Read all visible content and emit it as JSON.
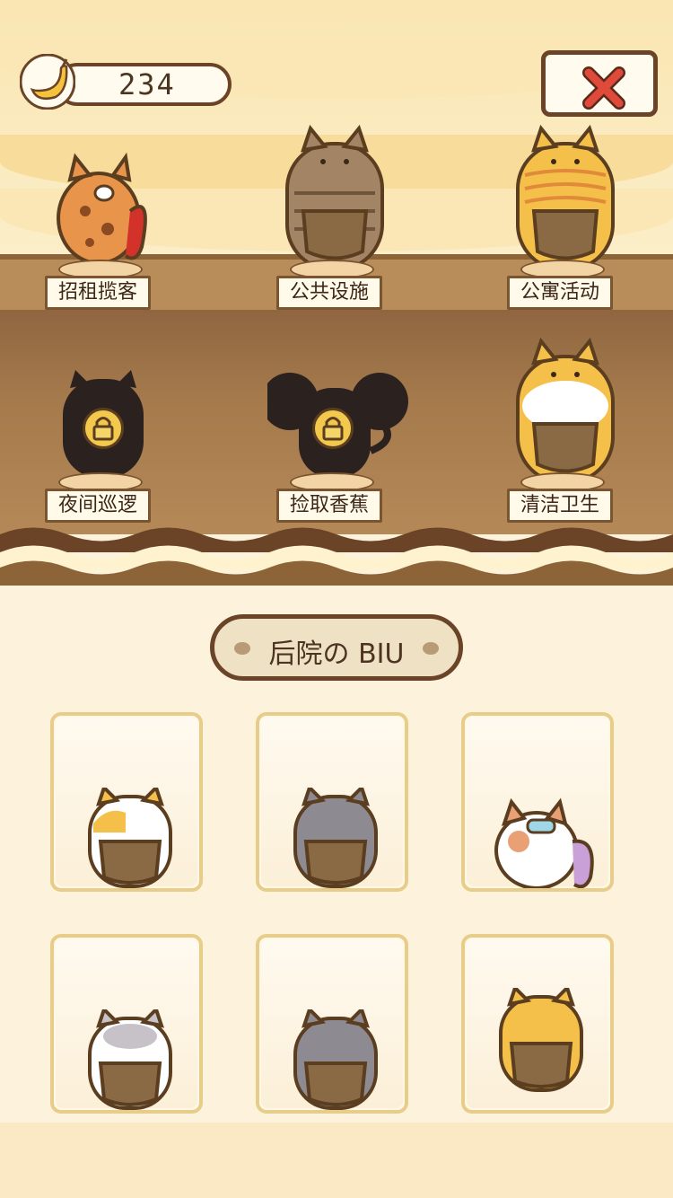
{
  "hud": {
    "banana_count": "234",
    "banana_icon": "banana-icon",
    "close_icon": "close-x-icon"
  },
  "shelf_top": [
    {
      "label": "招租揽客",
      "cat": "orange-spotted-cat",
      "locked": false
    },
    {
      "label": "公共设施",
      "cat": "tabby-cat",
      "locked": false
    },
    {
      "label": "公寓活动",
      "cat": "orange-striped-cat",
      "locked": false
    }
  ],
  "shelf_bottom": [
    {
      "label": "夜间巡逻",
      "cat": "silhouette-cat",
      "locked": true
    },
    {
      "label": "捡取香蕉",
      "cat": "silhouette-mouse",
      "locked": true
    },
    {
      "label": "清洁卫生",
      "cat": "orange-white-cat",
      "locked": false
    }
  ],
  "backyard": {
    "title": "后院の BIU",
    "cats": [
      {
        "cat": "calico-apron-cat"
      },
      {
        "cat": "gray-apron-cat"
      },
      {
        "cat": "calico-goggles-cat"
      },
      {
        "cat": "white-gray-apron-cat"
      },
      {
        "cat": "gray-apron-cat"
      },
      {
        "cat": "yellow-apron-cat"
      }
    ]
  },
  "colors": {
    "accent_brown": "#6b4428",
    "close_red": "#e04a3a",
    "card_border": "#e8cc8a",
    "lock_gold": "#f2c94c"
  }
}
